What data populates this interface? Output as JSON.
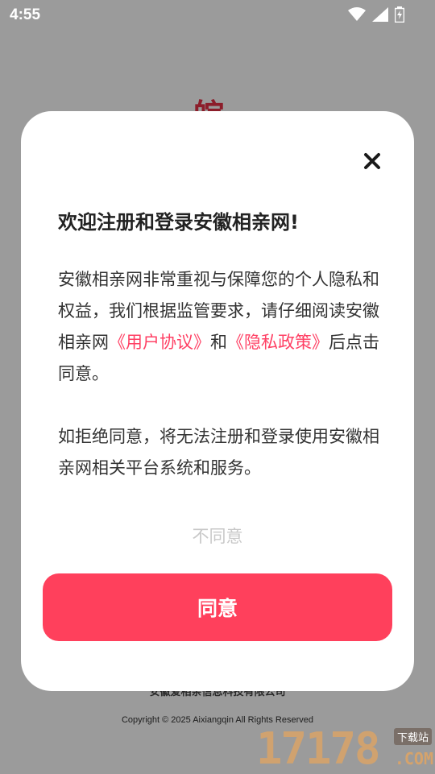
{
  "status_bar": {
    "time": "4:55",
    "icons": [
      "wifi-icon",
      "signal-icon",
      "battery-charging-icon"
    ]
  },
  "background_page": {
    "logo_text": "皖",
    "company": "安徽爱相亲信息科技有限公司",
    "copyright": "Copyright © 2025 Aixiangqin All Rights Reserved"
  },
  "dialog": {
    "close_icon": "close-icon",
    "title": "欢迎注册和登录安徽相亲网!",
    "para1_before": "安徽相亲网非常重视与保障您的个人隐私和权益，我们根据监管要求，请仔细阅读安徽相亲网",
    "link_user_agreement": "《用户协议》",
    "para1_and": "和",
    "link_privacy_policy": "《隐私政策》",
    "para1_after": "后点击同意。",
    "para2": "如拒绝同意，将无法注册和登录使用安徽相亲网相关平台系统和服务。",
    "disagree_label": "不同意",
    "agree_label": "同意"
  },
  "watermark": {
    "number": "17178",
    "tag": "下载站",
    "domain": ".COM"
  },
  "colors": {
    "accent": "#ff405c",
    "link": "#ff4064",
    "overlay": "#9b9b9b"
  }
}
